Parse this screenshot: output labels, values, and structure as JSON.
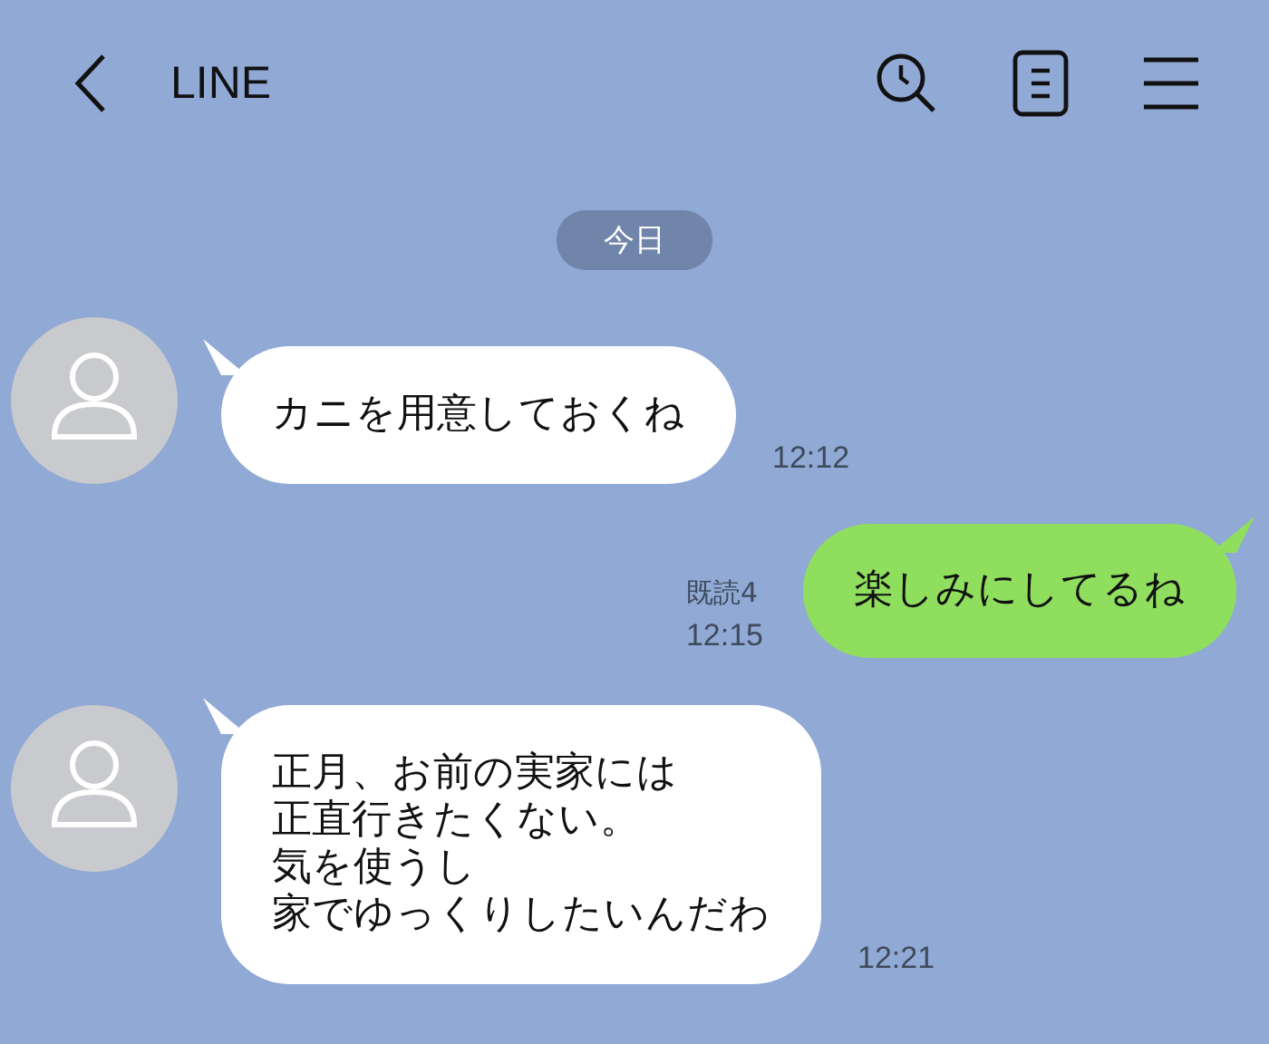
{
  "header": {
    "title": "LINE"
  },
  "date_label": "今日",
  "messages": [
    {
      "kind": "received",
      "lines": [
        "カニを用意しておくね"
      ],
      "time": "12:12"
    },
    {
      "kind": "sent",
      "lines": [
        "楽しみにしてるね"
      ],
      "read": "既読4",
      "time": "12:15"
    },
    {
      "kind": "received",
      "lines": [
        "正月、お前の実家には",
        "正直行きたくない。",
        "気を使うし",
        "家でゆっくりしたいんだわ"
      ],
      "time": "12:21"
    }
  ]
}
